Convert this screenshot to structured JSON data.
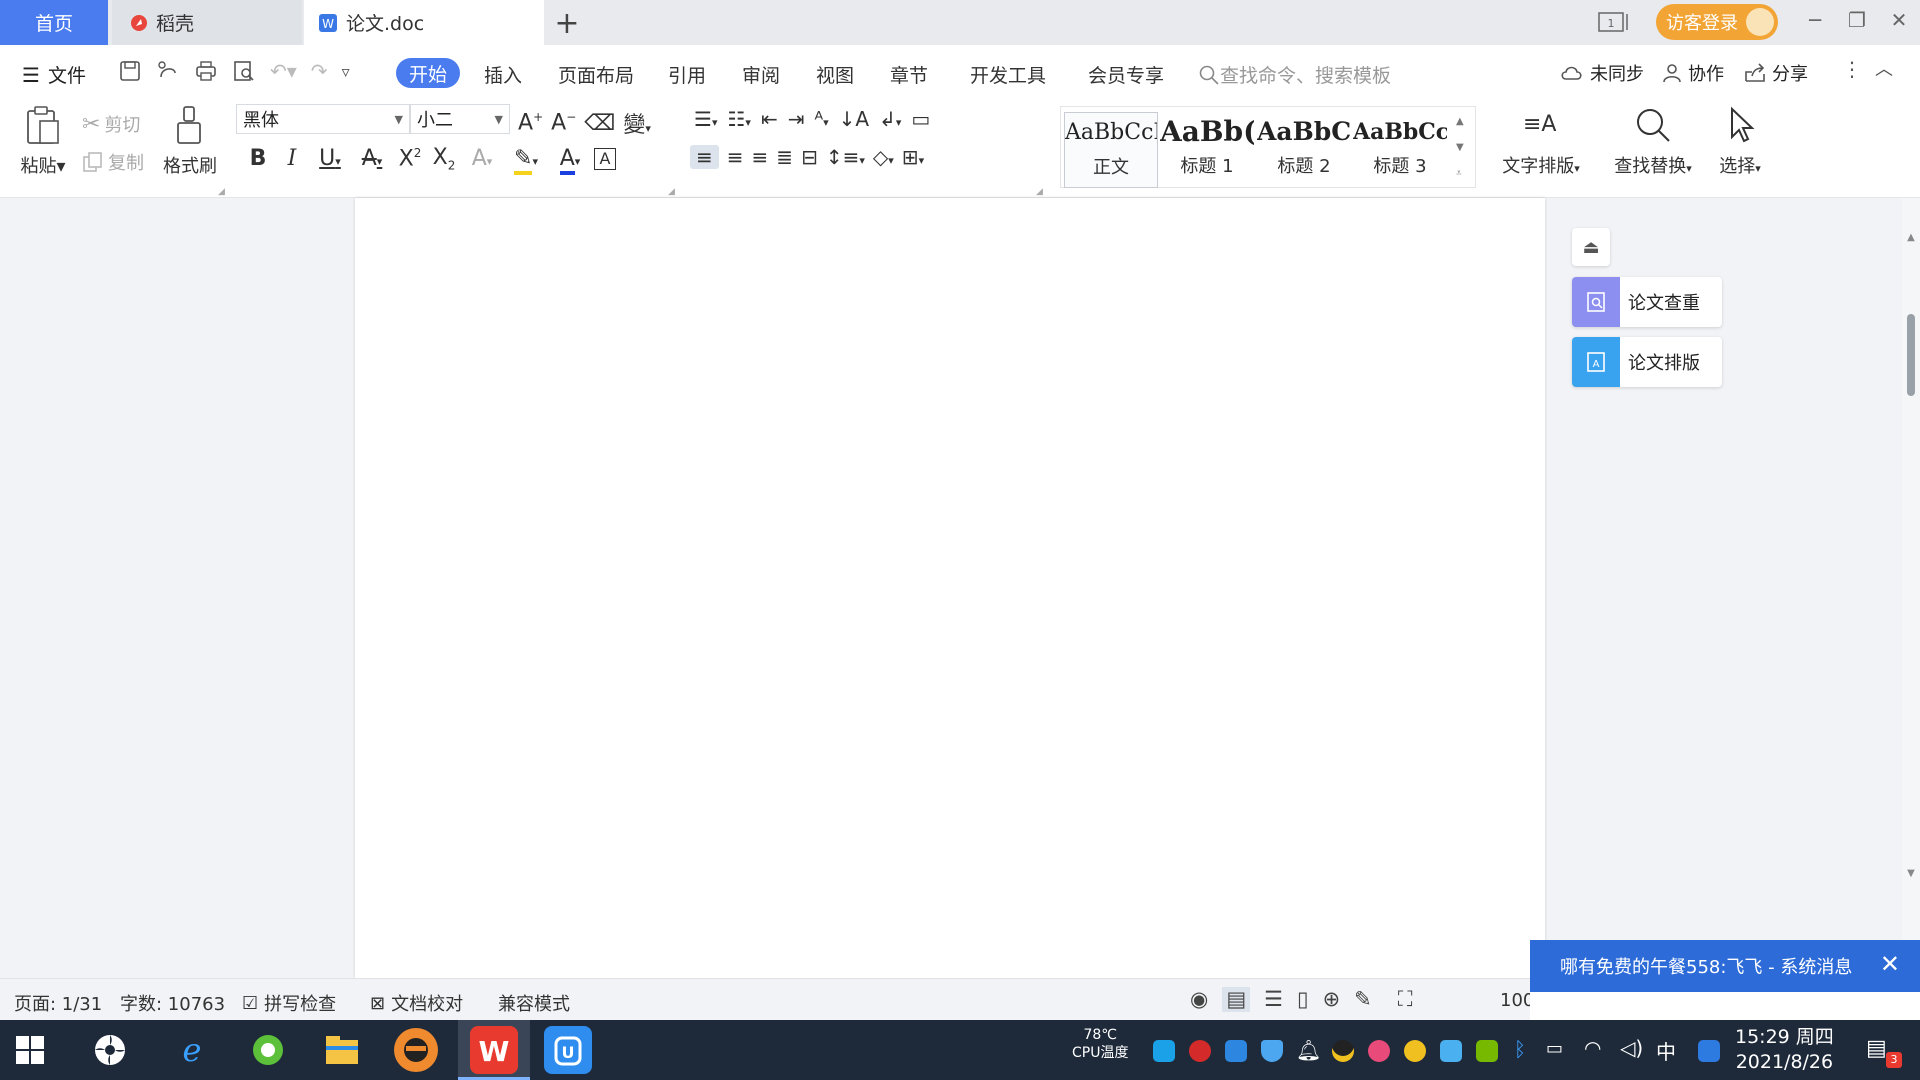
{
  "tabs": {
    "home": "首页",
    "daoke": "稻壳",
    "doc": "论文.doc"
  },
  "guest_login": "访客登录",
  "menu": {
    "file": "文件",
    "items": [
      "开始",
      "插入",
      "页面布局",
      "引用",
      "审阅",
      "视图",
      "章节",
      "开发工具",
      "会员专享"
    ],
    "search_placeholder": "查找命令、搜索模板",
    "sync": "未同步",
    "collab": "协作",
    "share": "分享"
  },
  "ribbon": {
    "paste": "粘贴",
    "cut": "剪切",
    "copy": "复制",
    "format_painter": "格式刷",
    "font_name": "黑体",
    "font_size": "小二",
    "styles": [
      {
        "preview": "AaBbCcI",
        "name": "正文"
      },
      {
        "preview": "AaBb(",
        "name": "标题 1"
      },
      {
        "preview": "AaBbC",
        "name": "标题 2"
      },
      {
        "preview": "AaBbCcl",
        "name": "标题 3"
      }
    ],
    "text_layout": "文字排版",
    "find_replace": "查找替换",
    "select": "选择"
  },
  "side_panel": {
    "check": "论文查重",
    "format": "论文排版"
  },
  "status": {
    "page": "页面: 1/31",
    "words": "字数: 10763",
    "spell": "拼写检查",
    "proof": "文档校对",
    "compat": "兼容模式",
    "zoom": "100"
  },
  "notification": {
    "text": "哪有免费的午餐558:飞飞 - 系统消息"
  },
  "taskbar": {
    "cpu_temp": "78℃",
    "cpu_label": "CPU温度",
    "ime": "中",
    "time": "15:29 周四",
    "date": "2021/8/26",
    "badge": "3"
  },
  "colors": {
    "accent": "#4a7cf0",
    "guest": "#f2a435",
    "notif": "#2d6bd8",
    "taskbar": "#1e2a3a"
  }
}
